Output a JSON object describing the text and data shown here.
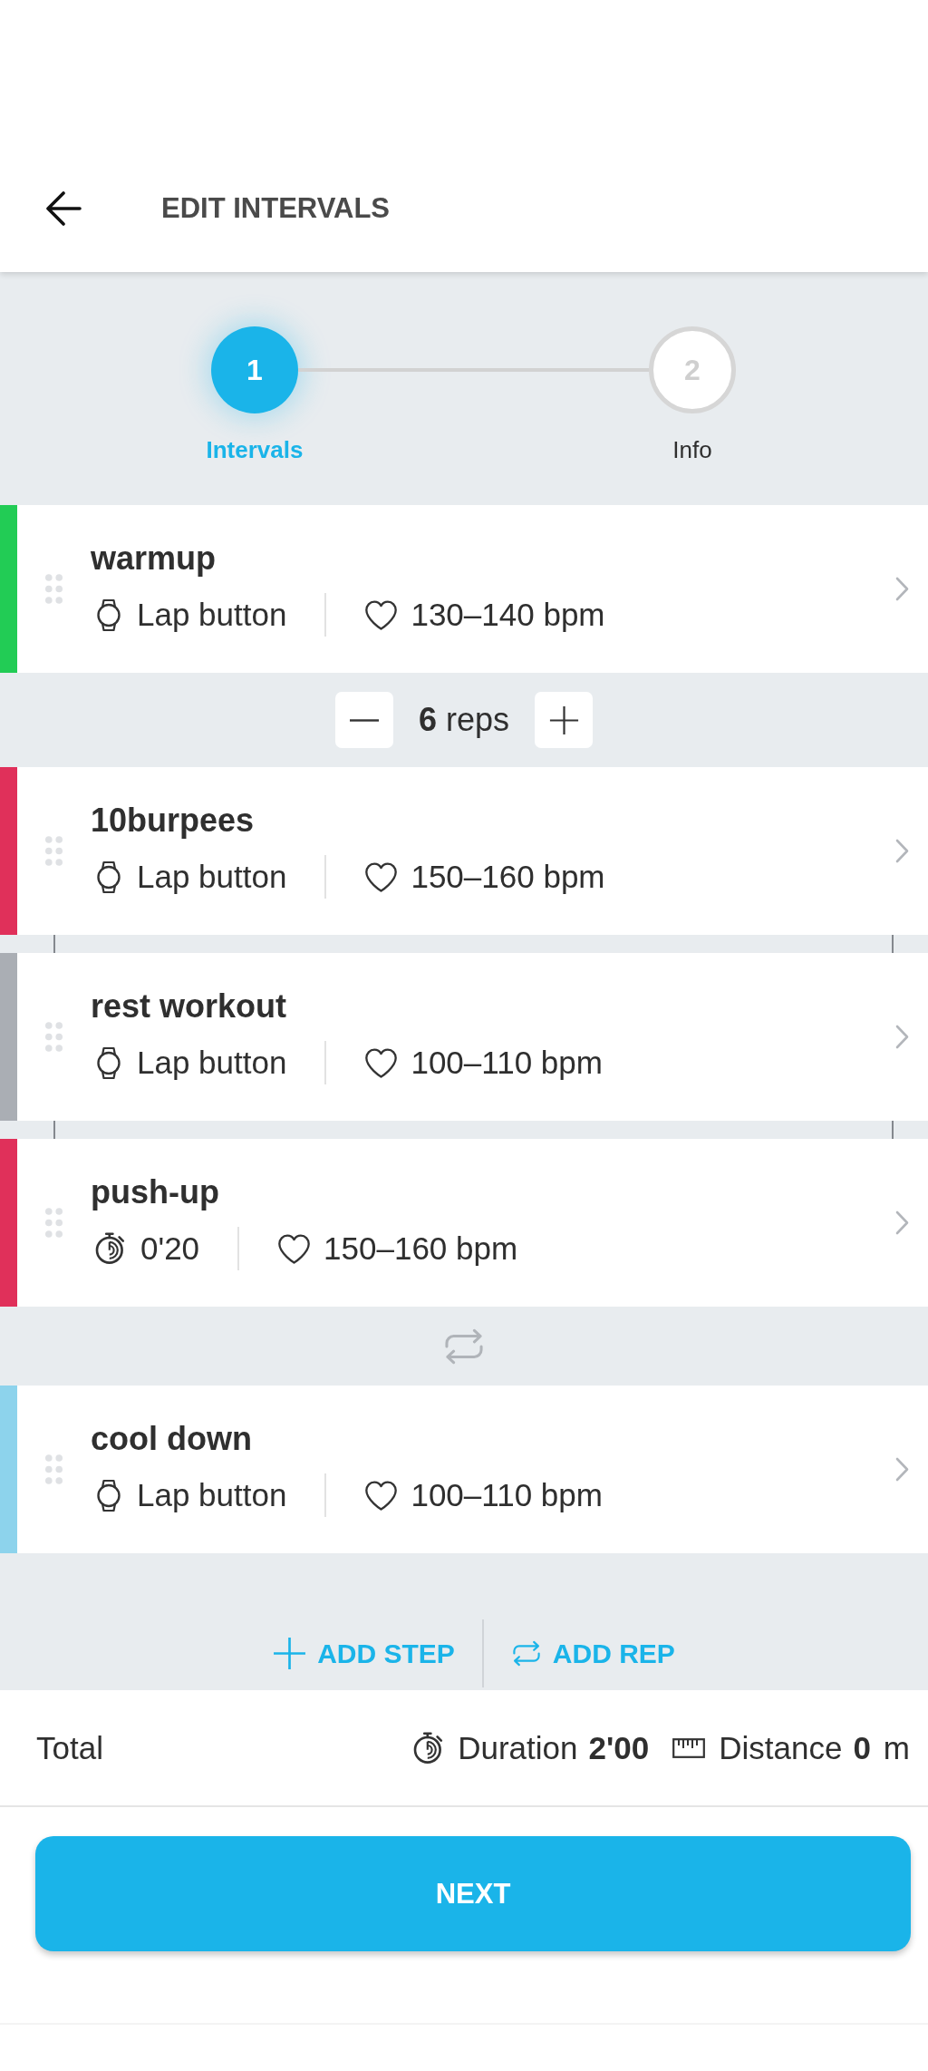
{
  "header": {
    "title": "EDIT INTERVALS"
  },
  "stepper": {
    "steps": [
      {
        "number": "1",
        "label": "Intervals",
        "selected": true
      },
      {
        "number": "2",
        "label": "Info",
        "selected": false
      }
    ]
  },
  "intervals": [
    {
      "kind": "step",
      "name": "warmup",
      "color": "#22cc55",
      "target": {
        "kind": "lap",
        "text": "Lap button"
      },
      "heart_rate": "130–140 bpm"
    },
    {
      "kind": "repeat",
      "reps": "**6** reps",
      "steps": [
        {
          "name": "10burpees",
          "color": "#e0305a",
          "target": {
            "kind": "lap",
            "text": "Lap button"
          },
          "heart_rate": "150–160 bpm"
        },
        {
          "name": "rest workout",
          "color": "#aaaeb4",
          "target": {
            "kind": "lap",
            "text": "Lap button"
          },
          "heart_rate": "100–110 bpm"
        },
        {
          "name": "push-up",
          "color": "#e0305a",
          "target": {
            "kind": "duration",
            "text": "0'20"
          },
          "heart_rate": "150–160 bpm"
        }
      ]
    },
    {
      "kind": "step",
      "name": "cool down",
      "color": "#8dd3ec",
      "target": {
        "kind": "lap",
        "text": "Lap button"
      },
      "heart_rate": "100–110 bpm"
    }
  ],
  "actions": [
    {
      "kind": "add_step",
      "label": "ADD STEP"
    },
    {
      "kind": "add_rep",
      "label": "ADD REP"
    }
  ],
  "total": {
    "label": "Total",
    "stats": [
      {
        "kind": "duration",
        "label": "Duration",
        "value": "2'00"
      },
      {
        "kind": "distance",
        "label": "Distance",
        "value": "0",
        "unit": "m"
      }
    ]
  },
  "primary_button": {
    "label": "NEXT"
  }
}
